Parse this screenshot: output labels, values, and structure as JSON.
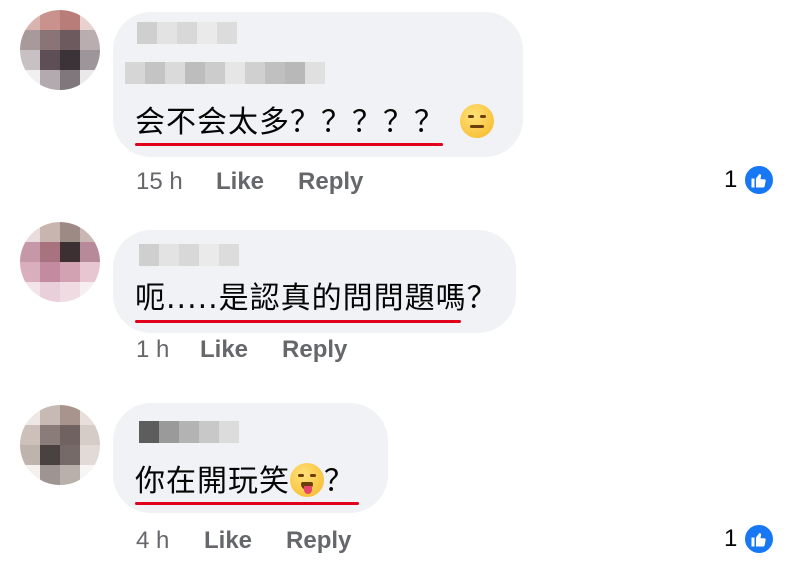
{
  "comments": [
    {
      "text": "会不会太多？？？？？",
      "emoji": "raised-eyebrow-emoji",
      "time": "15 h",
      "like_label": "Like",
      "reply_label": "Reply",
      "reaction_count": "1"
    },
    {
      "text": "呃.....是認真的問問題嗎？",
      "emoji": "",
      "time": "1 h",
      "like_label": "Like",
      "reply_label": "Reply",
      "reaction_count": ""
    },
    {
      "text": "你在開玩笑",
      "text_suffix": "？",
      "emoji": "squinting-tongue-emoji",
      "time": "4 h",
      "like_label": "Like",
      "reply_label": "Reply",
      "reaction_count": "1"
    }
  ],
  "colors": {
    "bubble": "#f0f2f5",
    "underline": "#e0001b",
    "meta_text": "#65676b",
    "like_blue": "#1877f2"
  },
  "icons": {
    "reaction": "thumbs-up-icon"
  }
}
